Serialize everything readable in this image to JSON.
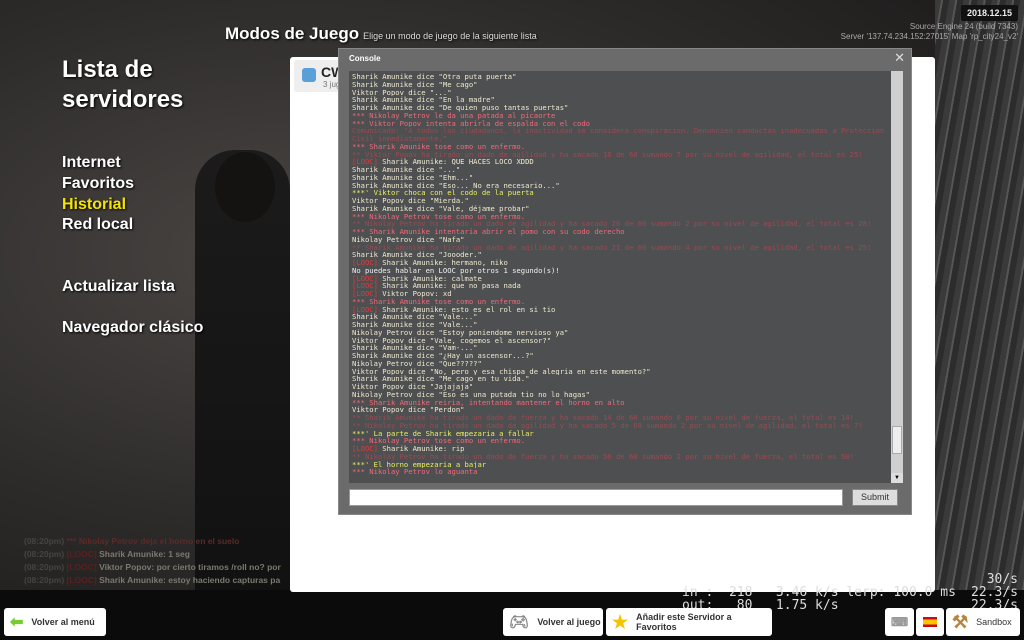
{
  "header": {
    "date": "2018.12.15",
    "engine": "Source Engine 24 (build 7343)",
    "server": "Server '137.74.234.152:27015' Map 'rp_city24_v2'",
    "title": "Modos de Juego",
    "subtitle": "Elige un modo de juego de la siguiente lista"
  },
  "sidebar": {
    "title": "Lista de servidores",
    "items": [
      {
        "label": "Internet"
      },
      {
        "label": "Favoritos"
      },
      {
        "label": "Historial",
        "active": true
      },
      {
        "label": "Red local"
      }
    ],
    "refresh": "Actualizar lista",
    "classic": "Navegador clásico"
  },
  "card": {
    "name": "CW",
    "sub": "3 jug"
  },
  "console": {
    "title": "Console",
    "submit": "Submit",
    "input_value": "",
    "lines": [
      {
        "t": "say",
        "s": "Sharik Amunike dice \"Otra puta puerta\""
      },
      {
        "t": "say",
        "s": "Sharik Amunike dice \"Me cago\""
      },
      {
        "t": "say",
        "s": "Viktor Popov dice \"...\""
      },
      {
        "t": "say",
        "s": "Sharik Amunike dice \"En la madre\""
      },
      {
        "t": "say",
        "s": "Sharik Amunike dice \"De quien puso tantas puertas\""
      },
      {
        "t": "me",
        "s": "*** Nikolay Petrov le da una patada al picaorte"
      },
      {
        "t": "me",
        "s": "*** Viktor Popov intenta abrirla de espalda con el codo"
      },
      {
        "t": "dim",
        "s": "Comunicado: \"A todos los ciudadanos, la inactividad se considera conspiracion. Denuncien conductas inadecuadas a Proteccion"
      },
      {
        "t": "dim",
        "s": "Civil inmediatamente.\""
      },
      {
        "t": "me",
        "s": "*** Sharik Amunike tose como un enfermo."
      },
      {
        "t": "dim",
        "s": "** Viktor Popov  ha tirado un dado de agilidad y ha sacado  18 de 60 sumando 7 por su nivel de agilidad, el total es 25!"
      },
      {
        "t": "looc",
        "p": "[LOOC]",
        "s": " Sharik Amunike: QUE HACES LOCO XDDD"
      },
      {
        "t": "say",
        "s": "Sharik Amunike dice \"...\""
      },
      {
        "t": "say",
        "s": "Sharik Amunike dice \"Ehm...\""
      },
      {
        "t": "say",
        "s": "Sharik Amunike dice \"Eso... No era necesario...\""
      },
      {
        "t": "it",
        "s": "***' Viktor choca con el codo de la puerta"
      },
      {
        "t": "say",
        "s": "Viktor Popov dice \"Mierda.\""
      },
      {
        "t": "say",
        "s": "Sharik Amunike dice \"Vale, déjame probar\""
      },
      {
        "t": "me",
        "s": "*** Nikolay Petrov tose como un enfermo."
      },
      {
        "t": "dim",
        "s": "** Nikolay Petrov  ha tirado un dado de agilidad y ha sacado  26 de 60 sumando 2 por su nivel de agilidad, el total es 28!"
      },
      {
        "t": "me",
        "s": "*** Sharik Amunike intentaria abrir el pomo con su codo derecho"
      },
      {
        "t": "say",
        "s": "Nikolay Petrov dice \"Nafa\""
      },
      {
        "t": "dim",
        "s": "** Sharik Amunike  ha tirado un dado de agilidad y ha sacado  21 de 60 sumando 4 por su nivel de agilidad, el total es 25!"
      },
      {
        "t": "say",
        "s": "Sharik Amunike dice \"Joooder.\""
      },
      {
        "t": "looc",
        "p": "[LOOC]",
        "s": " Sharik Amunike: hermano, niko"
      },
      {
        "t": "sys",
        "s": "No puedes hablar en LOOC por otros 1 segundo(s)!"
      },
      {
        "t": "looc",
        "p": "[LOOC]",
        "s": " Sharik Amunike: calmate"
      },
      {
        "t": "looc",
        "p": "[LOOC]",
        "s": " Sharik Amunike: que no pasa nada"
      },
      {
        "t": "looc",
        "p": "[LOOC]",
        "s": " Viktor Popov: xd"
      },
      {
        "t": "me",
        "s": "*** Sharik Amunike tose como un enfermo."
      },
      {
        "t": "looc",
        "p": "[LOOC]",
        "s": " Sharik Amunike: esto es el rol en si tio"
      },
      {
        "t": "say",
        "s": "Sharik Amunike dice \"Vale...\""
      },
      {
        "t": "say",
        "s": "Sharik Amunike dice \"Vale...\""
      },
      {
        "t": "say",
        "s": "Nikolay Petrov dice \"Estoy poniendome nervioso ya\""
      },
      {
        "t": "say",
        "s": "Viktor Popov dice \"Vale, cogemos el ascensor?\""
      },
      {
        "t": "say",
        "s": "Sharik Amunike dice \"Vam-...\""
      },
      {
        "t": "say",
        "s": "Sharik Amunike dice \"¿Hay un ascensor...?\""
      },
      {
        "t": "say",
        "s": "Nikolay Petrov dice \"Que?????\""
      },
      {
        "t": "say",
        "s": "Viktor Popov dice \"No, pero y esa chispa de alegria en este momento?\""
      },
      {
        "t": "say",
        "s": "Sharik Amunike dice \"Me cago en tu vida.\""
      },
      {
        "t": "say",
        "s": "Viktor Popov dice \"Jajajaja\""
      },
      {
        "t": "say",
        "s": "Nikolay Petrov dice \"Eso es una putada tio no lo hagas\""
      },
      {
        "t": "me",
        "s": "*** Sharik Amunike reiria, intentando mantener el horno en alto"
      },
      {
        "t": "say",
        "s": "Viktor Popov dice \"Perdon\""
      },
      {
        "t": "dim",
        "s": "** Sharik Amunike  ha tirado un dado de fuerza y ha sacado 14 de 60 sumando 0 por su nivel de fuerza, el total es 14!"
      },
      {
        "t": "dim",
        "s": "** Nikolay Petrov  ha tirado un dado de agilidad y ha sacado  5 de 60 sumando 2 por su nivel de agilidad, el total es 7!"
      },
      {
        "t": "it",
        "s": "***' La parte de Sharik empezaria a fallar"
      },
      {
        "t": "me",
        "s": "*** Nikolay Petrov tose como un enfermo."
      },
      {
        "t": "looc",
        "p": "[LOOC]",
        "s": " Sharik Amunike: rip"
      },
      {
        "t": "dim",
        "s": "** Nikolay Petrov  ha tirado un dado de fuerza y ha sacado 56 de 60 sumando 2 por su nivel de fuerza, el total es 58!"
      },
      {
        "t": "it",
        "s": "***' El horno empezaria a bajar"
      },
      {
        "t": "me",
        "s": "*** Nikolay Petrov lo aguanta"
      }
    ]
  },
  "chat": [
    {
      "time": "(08:20pm)",
      "tag": "***",
      "text": " Nikolay Petrov deja el horno en el suelo"
    },
    {
      "time": "(08:20pm)",
      "tag": "[LOOC]",
      "text": " Sharik Amunike: 1 seg"
    },
    {
      "time": "(08:20pm)",
      "tag": "[LOOC]",
      "text": " Viktor Popov: por cierto tiramos /roll no? por"
    },
    {
      "time": "(08:20pm)",
      "tag": "[LOOC]",
      "text": " Sharik Amunike: estoy haciendo capturas pa"
    }
  ],
  "netgraph": {
    "fps": "30/s",
    "line1": "in :  218   3.46 k/s lerp: 100.0 ms",
    "rate1": "22.3/s",
    "line2": "out:   80   1.75 k/s",
    "rate2": "22.3/s"
  },
  "footer": {
    "back_menu": "Volver al menú",
    "back_game": "Volver al juego",
    "add_fav": "Añadir este Servidor a Favoritos",
    "gamemode": "Sandbox"
  }
}
